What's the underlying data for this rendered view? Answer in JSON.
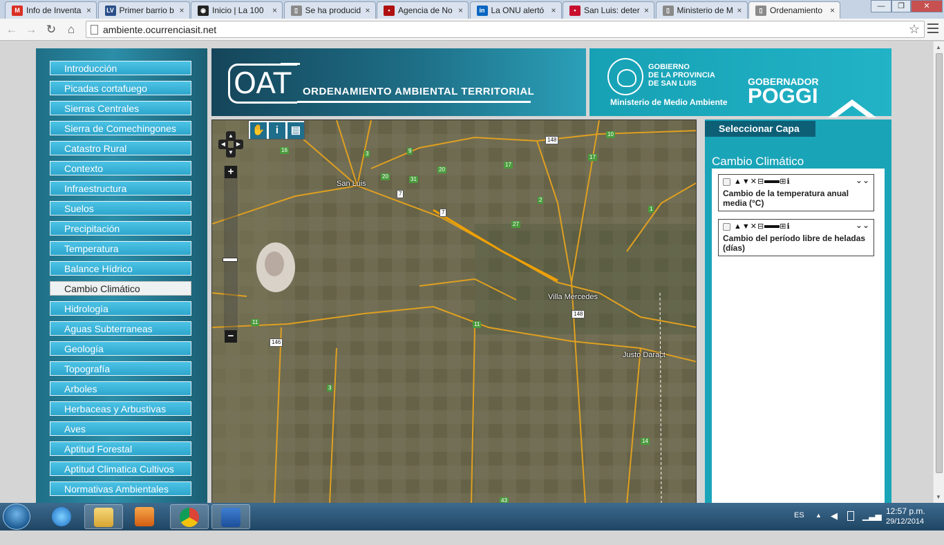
{
  "browser": {
    "tabs": [
      {
        "label": "Info de Inventa",
        "icon": "gmail-icon",
        "color": "#d93025",
        "glyph": "M"
      },
      {
        "label": "Primer barrio b",
        "icon": "lv-icon",
        "color": "#2a4f8a",
        "glyph": "LV"
      },
      {
        "label": "Inicio | La 100",
        "icon": "globe-icon",
        "color": "#222222",
        "glyph": "◉"
      },
      {
        "label": "Se ha producid",
        "icon": "page-icon",
        "color": "#8a8a8a",
        "glyph": "▯"
      },
      {
        "label": "Agencia de No",
        "icon": "news-icon",
        "color": "#b01010",
        "glyph": "▪"
      },
      {
        "label": "La ONU alertó",
        "icon": "linkedin-icon",
        "color": "#0a66c2",
        "glyph": "in"
      },
      {
        "label": "San Luis: deter",
        "icon": "inta-icon",
        "color": "#c8102e",
        "glyph": "▪"
      },
      {
        "label": "Ministerio de M",
        "icon": "page-icon",
        "color": "#8a8a8a",
        "glyph": "▯"
      },
      {
        "label": "Ordenamiento",
        "icon": "page-icon",
        "color": "#8a8a8a",
        "glyph": "▯"
      }
    ],
    "close_glyph": "×",
    "window_controls": {
      "minimize": "—",
      "restore": "❐",
      "close": "✕"
    },
    "nav": {
      "back": "←",
      "forward": "→",
      "reload": "↻",
      "home": "⌂"
    },
    "url": "ambiente.ocurrenciasit.net",
    "star": "☆"
  },
  "sidebar": {
    "items": [
      "Introducción",
      "Picadas cortafuego",
      "Sierras Centrales",
      "Sierra de Comechingones",
      "Catastro Rural",
      "Contexto",
      "Infraestructura",
      "Suelos",
      "Precipitación",
      "Temperatura",
      "Balance Hídrico",
      "Cambio Climático",
      "Hidrología",
      "Aguas Subterraneas",
      "Geología",
      "Topografía",
      "Arboles",
      "Herbaceas y Arbustivas",
      "Aves",
      "Aptitud Forestal",
      "Aptitud Climatica Cultivos",
      "Normativas Ambientales"
    ],
    "active_index": 11
  },
  "banner": {
    "logo": "OAT",
    "subtitle": "ORDENAMIENTO AMBIENTAL TERRITORIAL"
  },
  "government": {
    "lines": [
      "GOBIERNO",
      "DE LA PROVINCIA",
      "DE SAN LUIS"
    ],
    "ministry": "Ministerio de Medio Ambiente",
    "gobernador_label": "GOBERNADOR",
    "gobernador_name": "POGGI"
  },
  "map": {
    "tools": {
      "pan": "✋",
      "info": "i",
      "print": "▤"
    },
    "pan": {
      "up": "▲",
      "down": "▼",
      "left": "◀",
      "right": "▶"
    },
    "zoom_in": "+",
    "zoom_out": "−",
    "cities": [
      "San Luis",
      "Villa Mercedes",
      "Justo Daract"
    ],
    "green_routes": [
      "3",
      "9",
      "16",
      "20",
      "31",
      "20",
      "17",
      "17",
      "10",
      "2",
      "27",
      "1",
      "11",
      "11",
      "3",
      "14",
      "43"
    ],
    "white_routes": [
      "148",
      "7",
      "7",
      "148",
      "146"
    ]
  },
  "layers_panel": {
    "header": "Seleccionar Capa",
    "group_title": "Cambio Climático",
    "layer_controls": {
      "up": "▲",
      "down": "▼",
      "remove": "✕",
      "minus": "⊟",
      "plus": "⊞",
      "info": "ℹ",
      "collapse": "⌄⌄"
    },
    "layers": [
      {
        "name": "Cambio de la temperatura anual media (°C)"
      },
      {
        "name": "Cambio del período libre de heladas (días)"
      }
    ]
  },
  "taskbar": {
    "language": "ES",
    "time": "12:57 p.m.",
    "date": "29/12/2014",
    "apps": [
      "ie-icon",
      "explorer-icon",
      "media-player-icon",
      "chrome-icon",
      "word-icon"
    ]
  },
  "colors": {
    "sidebar_button": "#2ea6cc",
    "banner_dark": "#15455a",
    "gov_teal": "#1aa4b8",
    "panel_header": "#0d5f76"
  }
}
